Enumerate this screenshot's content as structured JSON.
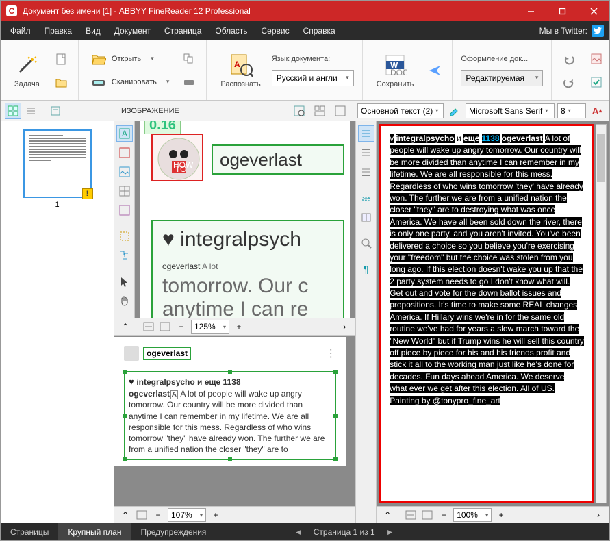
{
  "window": {
    "title": "Документ без имени [1] - ABBYY FineReader 12 Professional",
    "logo_letter": "С"
  },
  "menu": {
    "items": [
      "Файл",
      "Правка",
      "Вид",
      "Документ",
      "Страница",
      "Область",
      "Сервис",
      "Справка"
    ],
    "twitter": "Мы в Twitter:"
  },
  "ribbon": {
    "task": "Задача",
    "open": "Открыть",
    "scan": "Сканировать",
    "recognize": "Распознать",
    "lang_label": "Язык документа:",
    "lang_value": "Русский и англи",
    "save": "Сохранить",
    "layout_label": "Оформление док...",
    "layout_value": "Редактируемая"
  },
  "toolrow": {
    "image_label": "ИЗОБРАЖЕНИЕ",
    "style": "Основной текст (2)",
    "font": "Microsoft Sans Serif",
    "size": "8"
  },
  "thumb": {
    "page": "1"
  },
  "image_preview": {
    "timestamp_frag": "0.16",
    "username_small": "ogeverlast",
    "line1_a": "♥ integralpsych",
    "line2_a": "ogeverlast",
    "line2_b": " A lot",
    "line3": "tomorrow. Our c",
    "line4": "anytime I can re"
  },
  "closeup": {
    "username": "ogeverlast",
    "first_line": "integralpsycho и еще 1138",
    "body_bold": "ogeverlast",
    "body_rest": " A lot of people will wake up angry tomorrow. Our country will be more divided than anytime I can remember in my lifetime. We are all responsible for this mess. Regardless of who wins tomorrow \"they\" have already won. The further we are from a unified nation the closer \"they\" are to"
  },
  "text_pane": {
    "w1": "v",
    "w2": "integralpsycho",
    "w3": " и ",
    "w4": "еще",
    "num": "1138",
    "w5": "ogeverlast",
    "body": "A lot of people will wake up angry tomorrow. Our country will be more divided than anytime I can remember in my lifetime. We are all responsible for this mess. Regardless of who wins tomorrow 'they' have already won. The further we are from a unified nation the closer \"they\" are to destroying what was once America. We have all been sold down the river, there is only one party, and you aren't invited. You've been delivered a choice so you believe you're exercising your \"freedom\" but the choice was stolen from you long ago. If this election doesn't wake you up that the 2 party system needs to go I don't know what will. Get out and vote for the down ballot issues and propositions. It's time to make some REAL changes America. If Hillary wins we're in for the same old routine we've had for years a slow march toward the \"New World\" but if Trump wins he will sell this country off piece by piece for his and his friends profit and stick it all to the working man just like he's done for decades. Fun days ahead America. We deserve what ever we get after this election. All of US. Painting by @tonypro_fine_art"
  },
  "zoom": {
    "image": "125%",
    "text": "100%",
    "closeup": "107%"
  },
  "status": {
    "tabs": [
      "Страницы",
      "Крупный план",
      "Предупреждения"
    ],
    "page_nav": "Страница 1 из 1"
  }
}
